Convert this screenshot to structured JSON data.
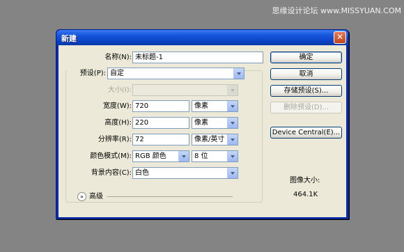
{
  "watermark": "思缘设计论坛 www.MISSYUAN.COM",
  "dialog": {
    "title": "新建",
    "close_glyph": "✕"
  },
  "fields": {
    "name": {
      "label": "名称(N):",
      "value": "未标题-1"
    },
    "preset": {
      "label": "预设(P):",
      "value": "自定"
    },
    "size": {
      "label": "大小(I):",
      "value": ""
    },
    "width": {
      "label": "宽度(W):",
      "value": "720",
      "unit": "像素"
    },
    "height": {
      "label": "高度(H):",
      "value": "220",
      "unit": "像素"
    },
    "resolution": {
      "label": "分辨率(R):",
      "value": "72",
      "unit": "像素/英寸"
    },
    "color_mode": {
      "label": "颜色模式(M):",
      "value": "RGB 颜色",
      "bits": "8 位"
    },
    "background": {
      "label": "背景内容(C):",
      "value": "白色"
    }
  },
  "advanced": {
    "label": "高级",
    "icon": "double-chevron-down-icon"
  },
  "buttons": {
    "ok": "确定",
    "cancel": "取消",
    "save_preset": "存储预设(S)...",
    "delete_preset": "删除预设(D)...",
    "device_central": "Device Central(E)..."
  },
  "image_size": {
    "label": "图像大小:",
    "value": "464.1K"
  },
  "colors": {
    "titlebar": "#0a3fc0",
    "client": "#ece9d8",
    "close": "#c5421a"
  }
}
